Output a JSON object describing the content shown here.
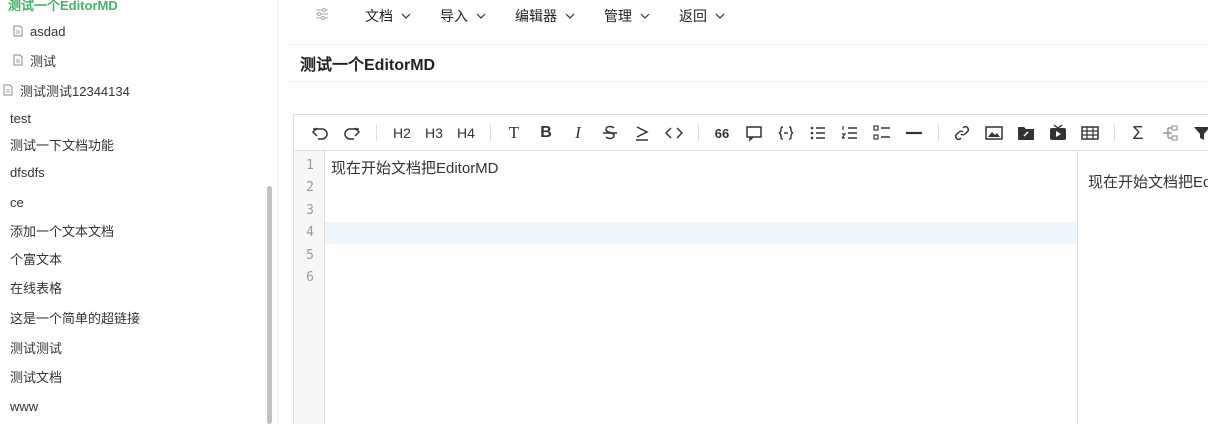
{
  "sidebar": {
    "items": [
      {
        "label": "测试一个EditorMD",
        "active": true
      },
      {
        "label": "asdad"
      },
      {
        "label": "测试"
      },
      {
        "label": "测试测试12344134"
      },
      {
        "label": "test"
      },
      {
        "label": "测试一下文档功能"
      },
      {
        "label": "dfsdfs"
      },
      {
        "label": "ce"
      },
      {
        "label": "添加一个文本文档"
      },
      {
        "label": "个富文本"
      },
      {
        "label": "在线表格"
      },
      {
        "label": "这是一个简单的超链接"
      },
      {
        "label": "测试测试"
      },
      {
        "label": "测试文档"
      },
      {
        "label": "www"
      }
    ]
  },
  "menu": {
    "items": [
      {
        "label": "文档"
      },
      {
        "label": "导入"
      },
      {
        "label": "编辑器"
      },
      {
        "label": "管理"
      },
      {
        "label": "返回"
      }
    ]
  },
  "document": {
    "title": "测试一个EditorMD"
  },
  "toolbar": {
    "h2": "H2",
    "h3": "H3",
    "h4": "H4",
    "bold": "B",
    "italic": "I",
    "text": "T",
    "quote": "66",
    "sum": "Σ"
  },
  "editor": {
    "line_numbers": [
      "1",
      "2",
      "3",
      "4",
      "5",
      "6"
    ],
    "lines": [
      "现在开始文档把EditorMD",
      "",
      "",
      "",
      "",
      ""
    ],
    "active_line": 4,
    "preview_text": "现在开始文档把EditorMD"
  },
  "colors": {
    "active_item": "#42b36a",
    "active_line_bg": "#eef6fb"
  }
}
